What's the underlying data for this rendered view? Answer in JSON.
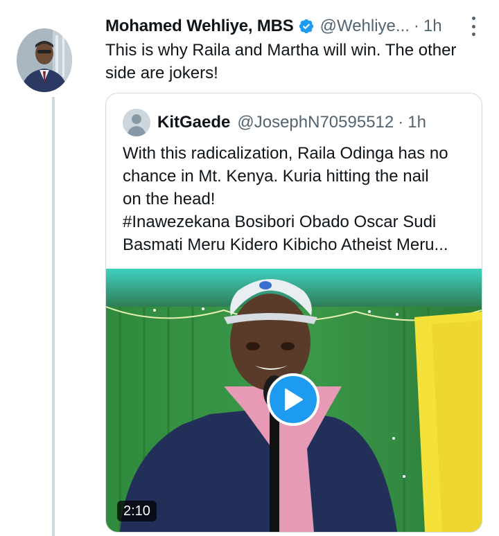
{
  "tweet": {
    "author_name": "Mohamed Wehliye, MBS",
    "handle": "@Wehliye...",
    "separator": "·",
    "time": "1h",
    "text": "This is why Raila and Martha will win. The other side are jokers!",
    "verified_icon": "verified-badge-icon",
    "more_icon": "more-options-icon"
  },
  "quoted_tweet": {
    "author_name": "KitGaede",
    "handle": "@JosephN70595512",
    "separator": "·",
    "time": "1h",
    "text_lines": [
      "With this radicalization, Raila Odinga has no",
      "chance in Mt. Kenya. Kuria hitting the nail",
      "on the head!",
      "#Inawezekana Bosibori Obado Oscar Sudi",
      "Basmati Meru Kidero Kibicho Atheist Meru..."
    ],
    "video": {
      "duration": "2:10",
      "play_icon": "play-icon"
    }
  },
  "colors": {
    "accent": "#1d9bf0",
    "secondary_text": "#536471",
    "border": "#cfd9de"
  }
}
